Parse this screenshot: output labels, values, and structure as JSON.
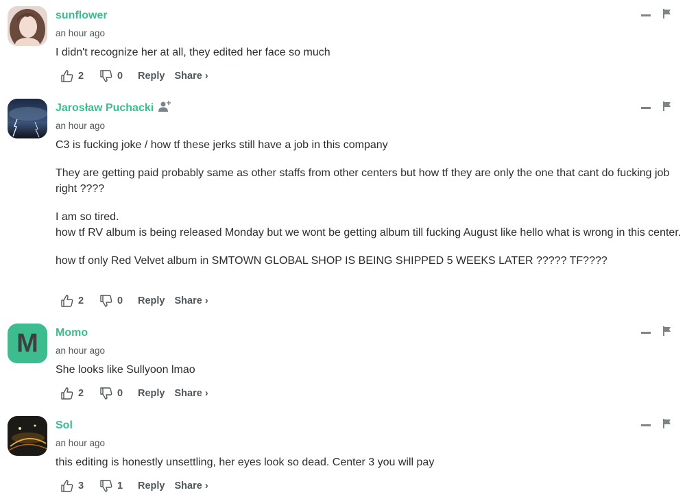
{
  "accent_color": "#3dbd8f",
  "icons": {
    "upvote": "thumbs-up-icon",
    "downvote": "thumbs-down-icon",
    "minimize": "minimize-icon",
    "flag": "flag-icon",
    "follow": "follow-user-icon"
  },
  "comments": [
    {
      "author": "sunflower",
      "avatar": "photo",
      "timestamp": "an hour ago",
      "body": [
        "I didn't recognize her at all, they edited her face so much"
      ],
      "upvotes": "2",
      "downvotes": "0",
      "reply_label": "Reply",
      "share_label": "Share ›"
    },
    {
      "author": "Jarosław Puchacki",
      "avatar": "photo",
      "timestamp": "an hour ago",
      "body": [
        "C3 is fucking joke / how tf these jerks still have a job in this company",
        "They are getting paid probably same as other staffs from other centers but how tf they are only the one that cant do fucking job right ????",
        "I am so tired.",
        "how tf RV album is being released Monday but we wont be getting album till fucking August like hello what is wrong in this center.",
        "how tf only Red Velvet album in SMTOWN GLOBAL SHOP IS BEING SHIPPED 5 WEEKS LATER ????? TF????"
      ],
      "upvotes": "2",
      "downvotes": "0",
      "reply_label": "Reply",
      "share_label": "Share ›"
    },
    {
      "author": "Momo",
      "avatar": "letter",
      "avatar_letter": "M",
      "avatar_color": "#3dbd8f",
      "timestamp": "an hour ago",
      "body": [
        "She looks like Sullyoon lmao"
      ],
      "upvotes": "2",
      "downvotes": "0",
      "reply_label": "Reply",
      "share_label": "Share ›"
    },
    {
      "author": "Sol",
      "avatar": "photo",
      "timestamp": "an hour ago",
      "body": [
        "this editing is honestly unsettling, her eyes look so dead. Center 3 you will pay"
      ],
      "upvotes": "3",
      "downvotes": "1",
      "reply_label": "Reply",
      "share_label": "Share ›"
    }
  ]
}
